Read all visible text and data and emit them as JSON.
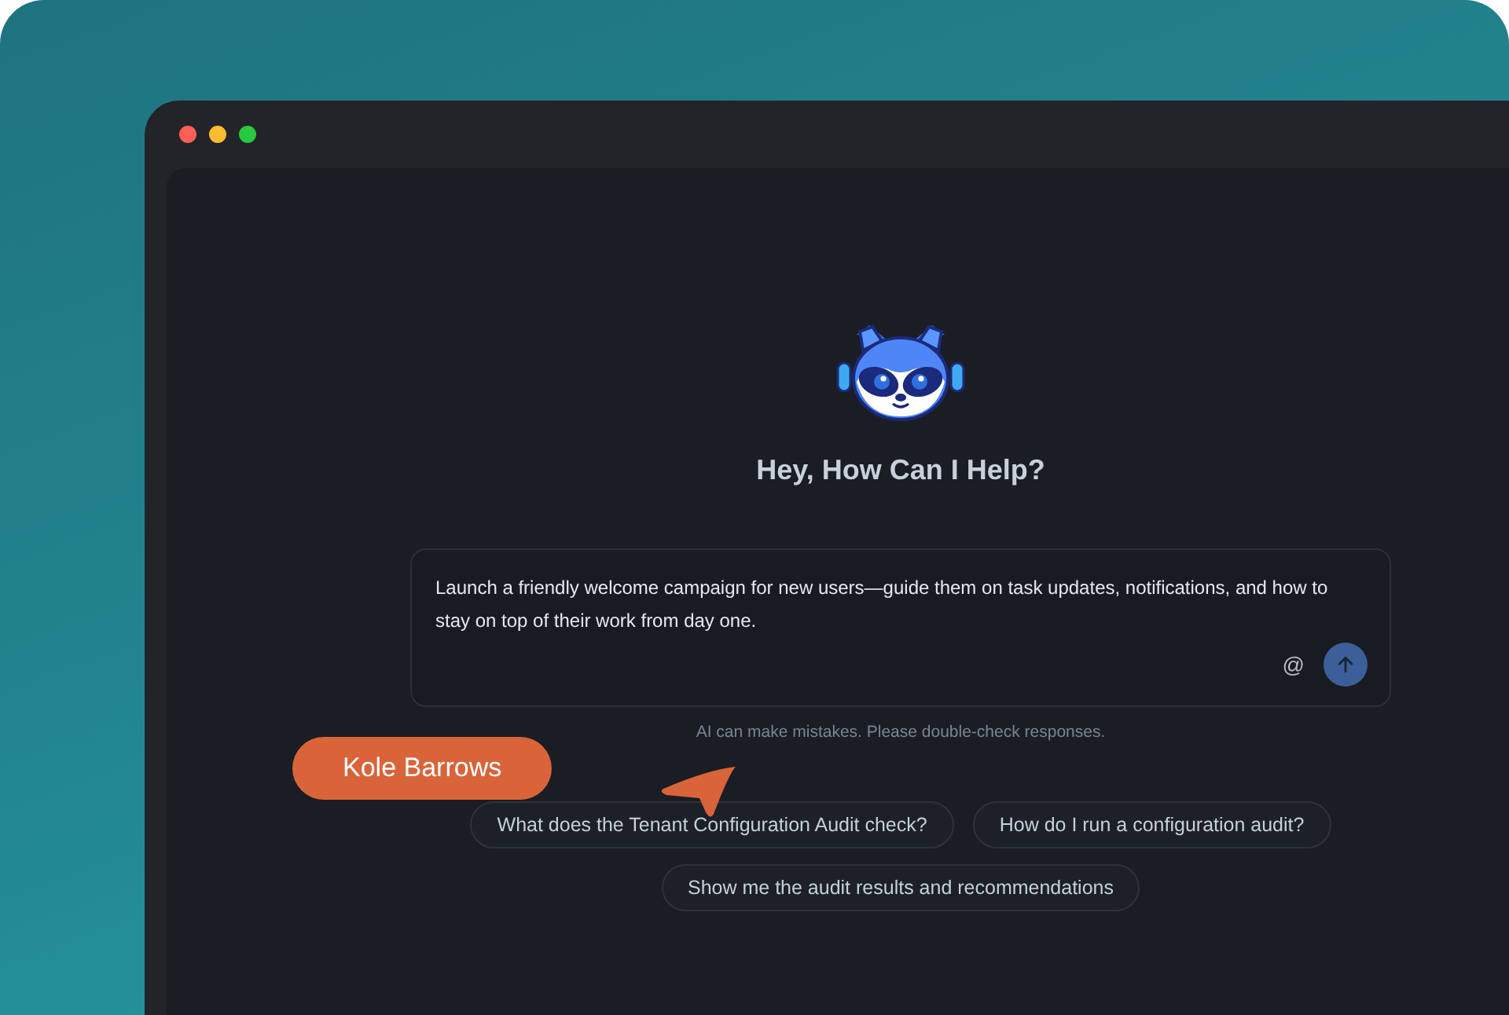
{
  "window": {
    "controls": [
      {
        "color": "#ff5f57"
      },
      {
        "color": "#febc2e"
      },
      {
        "color": "#28c840"
      }
    ]
  },
  "assistant": {
    "heading": "Hey, How Can I Help?"
  },
  "prompt": {
    "value": "Launch a friendly welcome campaign for new users—guide them on task updates, notifications, and how to stay on top of their work from day one.",
    "mention_symbol": "@"
  },
  "disclaimer": "AI can make mistakes. Please double-check responses.",
  "suggestions": [
    {
      "label": "What does the Tenant Configuration Audit check?"
    },
    {
      "label": "How do I run a configuration audit?"
    },
    {
      "label": "Show me the audit results and recommendations"
    }
  ],
  "cursor": {
    "label": "Kole Barrows"
  }
}
